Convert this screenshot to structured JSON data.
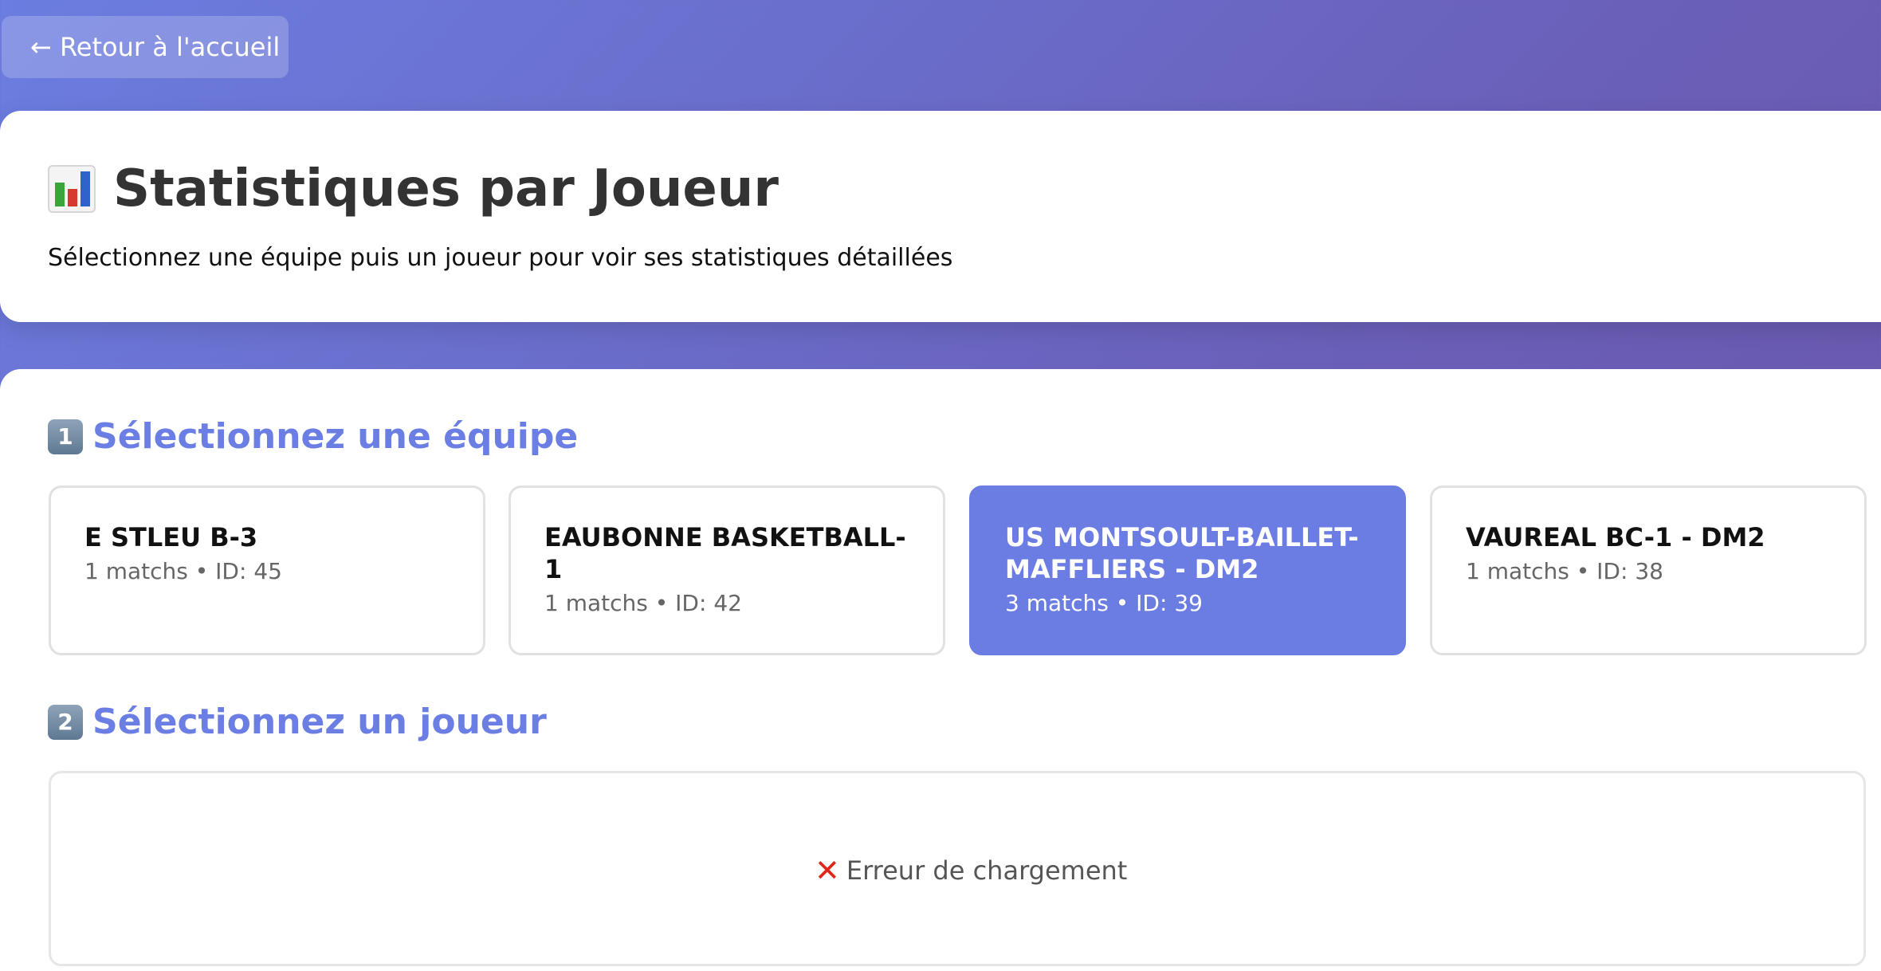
{
  "nav": {
    "back_label": "← Retour à l'accueil"
  },
  "header": {
    "title": "Statistiques par Joueur",
    "subtitle": "Sélectionnez une équipe puis un joueur pour voir ses statistiques détaillées",
    "icon": "bar-chart-icon"
  },
  "team_section": {
    "step": "1",
    "heading": "Sélectionnez une équipe",
    "teams": [
      {
        "name": "E STLEU B-3",
        "meta": "1 matchs • ID: 45",
        "selected": false
      },
      {
        "name": "EAUBONNE BASKETBALL-1",
        "meta": "1 matchs • ID: 42",
        "selected": false
      },
      {
        "name": "US MONTSOULT-BAILLET-MAFFLIERS - DM2",
        "meta": "3 matchs • ID: 39",
        "selected": true
      },
      {
        "name": "VAUREAL BC-1 - DM2",
        "meta": "1 matchs • ID: 38",
        "selected": false
      }
    ]
  },
  "player_section": {
    "step": "2",
    "heading": "Sélectionnez un joueur",
    "error_icon": "x-icon",
    "error_text": "Erreur de chargement"
  },
  "colors": {
    "accent": "#6b7de3",
    "error": "#e0261b",
    "background_start": "#6b7de0",
    "background_end": "#6a54a8"
  }
}
